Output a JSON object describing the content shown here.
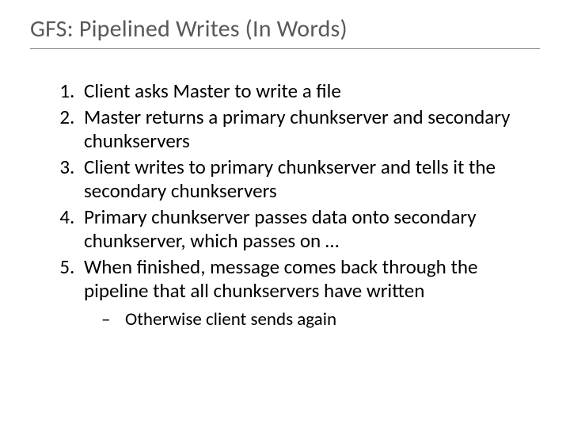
{
  "title": "GFS: Pipelined Writes (In Words)",
  "items": [
    "Client asks Master to write a file",
    "Master returns a primary chunkserver and secondary chunkservers",
    "Client writes to primary chunkserver and tells it the secondary chunkservers",
    "Primary chunkserver passes data onto secondary chunkserver, which passes on …",
    "When finished, message comes back through the pipeline that all chunkservers have written"
  ],
  "sub_item": "Otherwise client sends again"
}
